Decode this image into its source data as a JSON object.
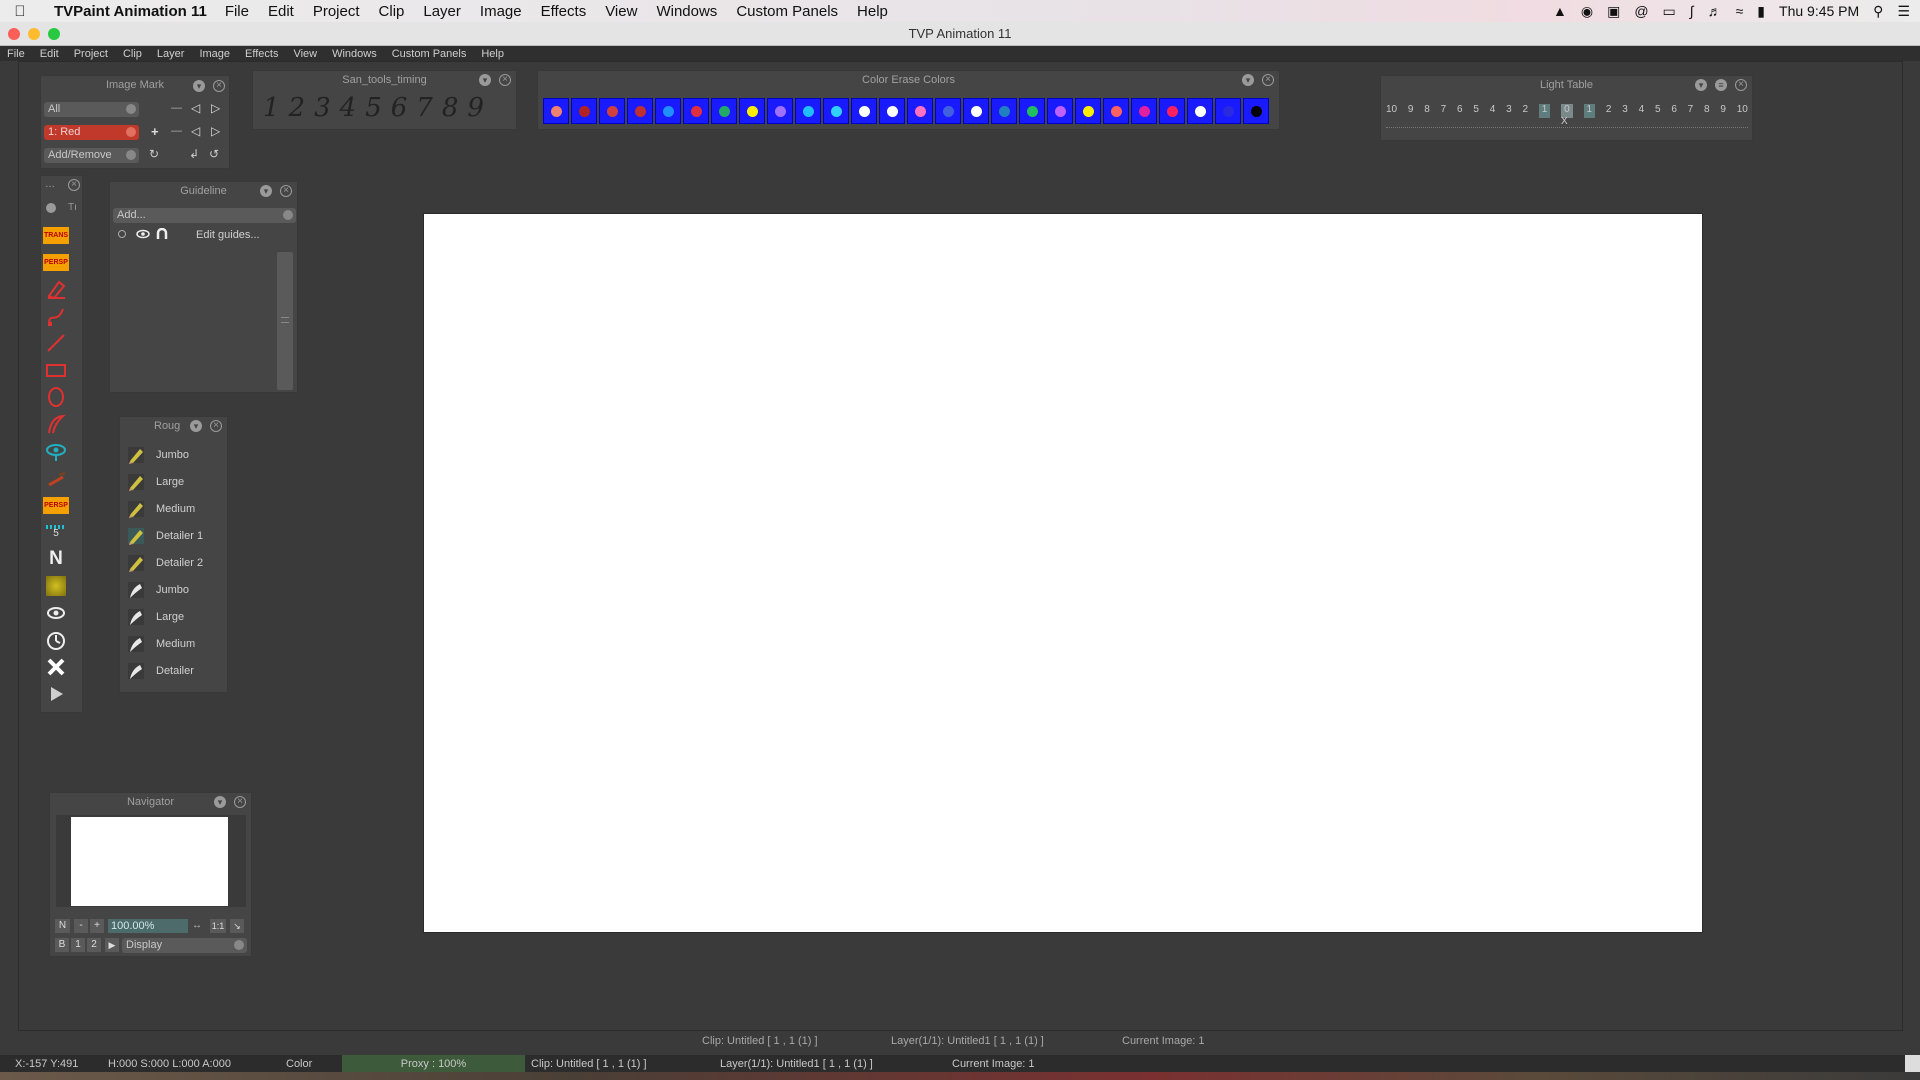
{
  "mac_menubar": {
    "app_name": "TVPaint Animation 11",
    "menus": [
      "File",
      "Edit",
      "Project",
      "Clip",
      "Layer",
      "Image",
      "Effects",
      "View",
      "Windows",
      "Custom Panels",
      "Help"
    ],
    "clock": "Thu 9:45 PM"
  },
  "window": {
    "title": "TVP Animation 11"
  },
  "app_menu": [
    "File",
    "Edit",
    "Project",
    "Clip",
    "Layer",
    "Image",
    "Effects",
    "View",
    "Windows",
    "Custom Panels",
    "Help"
  ],
  "image_mark": {
    "title": "Image Mark",
    "filter": "All",
    "mark": "1: Red",
    "mark_color": "#c0392b",
    "mode": "Add/Remove"
  },
  "timing": {
    "title": "San_tools_timing",
    "digits": [
      "1",
      "2",
      "3",
      "4",
      "5",
      "6",
      "7",
      "8",
      "9"
    ]
  },
  "color_erase": {
    "title": "Color Erase Colors",
    "dot_colors": [
      "#f08070",
      "#b22222",
      "#d04040",
      "#c03030",
      "#1e90ff",
      "#e03040",
      "#22aa66",
      "#ffee00",
      "#a070ff",
      "#20c0ff",
      "#30d0ff",
      "#ffffff",
      "#ffffff",
      "#ff70c0",
      "#4060e0",
      "#ffffff",
      "#2080c0",
      "#20c060",
      "#c060ff",
      "#ffee00",
      "#ff6060",
      "#e020a0",
      "#ff2060",
      "#ffffff",
      "#2a2ae0",
      "#000000"
    ]
  },
  "light_table": {
    "title": "Light Table",
    "left_numbers": [
      "10",
      "9",
      "8",
      "7",
      "6",
      "5",
      "4",
      "3",
      "2"
    ],
    "center_left": "1",
    "center": "0",
    "center_right": "1",
    "right_numbers": [
      "2",
      "3",
      "4",
      "5",
      "6",
      "7",
      "8",
      "9",
      "10"
    ],
    "marker": "X"
  },
  "toolbox": {
    "tab_label": "Tı",
    "tools": [
      "trans-icon",
      "persp-icon",
      "eraser-icon",
      "curve-icon",
      "line-icon",
      "rectangle-icon",
      "ellipse-icon",
      "freehand-icon",
      "eye-transform-icon",
      "brush-icon",
      "persp-icon",
      "ruler-icon",
      "n-icon",
      "gradient-icon",
      "eye-icon",
      "onion-icon",
      "close-icon",
      "play-icon"
    ],
    "trans_label": "TRANS",
    "persp_label": "PERSP",
    "persp2_label": "PERSP",
    "ruler_label": "5",
    "n_label": "N"
  },
  "guideline": {
    "title": "Guideline",
    "add_placeholder": "Add...",
    "edit_label": "Edit guides..."
  },
  "roug": {
    "title": "Roug",
    "items": [
      {
        "label": "Jumbo",
        "kind": "pencil"
      },
      {
        "label": "Large",
        "kind": "pencil"
      },
      {
        "label": "Medium",
        "kind": "pencil"
      },
      {
        "label": "Detailer 1",
        "kind": "pencil"
      },
      {
        "label": "Detailer 2",
        "kind": "pencil"
      },
      {
        "label": "Jumbo",
        "kind": "pen"
      },
      {
        "label": "Large",
        "kind": "pen"
      },
      {
        "label": "Medium",
        "kind": "pen"
      },
      {
        "label": "Detailer",
        "kind": "pen"
      }
    ]
  },
  "navigator": {
    "title": "Navigator",
    "n_btn": "N",
    "minus_btn": "-",
    "plus_btn": "+",
    "zoom": "100.00%",
    "ratio_btn": "1:1",
    "b_btn": "B",
    "one_btn": "1",
    "two_btn": "2",
    "display": "Display"
  },
  "status_top": {
    "clip": "Clip: Untitled [ 1 , 1  (1) ]",
    "layer": "Layer(1/1): Untitled1 [ 1 , 1  (1) ]",
    "current": "Current Image: 1"
  },
  "status_bottom": {
    "coords": "X:-157  Y:491",
    "hsla": "H:000 S:000 L:000 A:000",
    "color": "Color",
    "proxy": "Proxy : 100%",
    "clip": "Clip: Untitled [ 1 , 1  (1) ]",
    "layer": "Layer(1/1): Untitled1 [ 1 , 1  (1) ]",
    "current": "Current Image: 1"
  }
}
